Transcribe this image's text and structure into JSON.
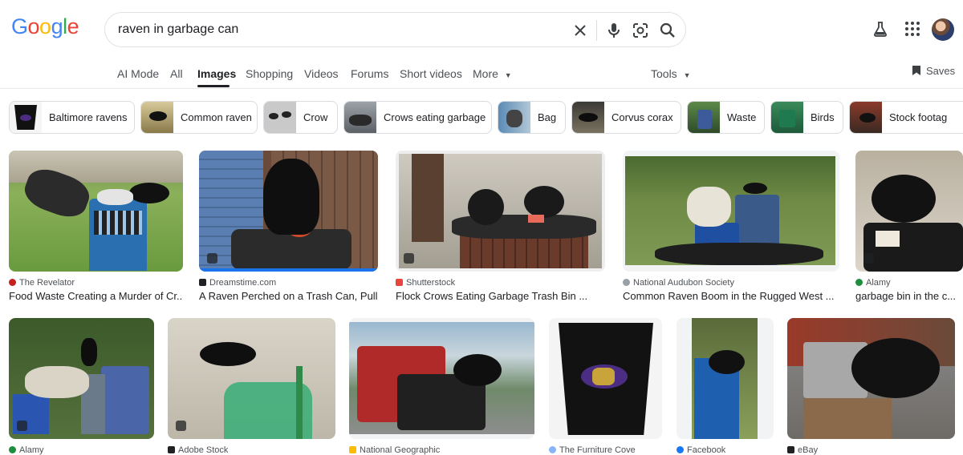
{
  "header": {
    "logo_letters": [
      {
        "ch": "G",
        "color": "#4285F4"
      },
      {
        "ch": "o",
        "color": "#EA4335"
      },
      {
        "ch": "o",
        "color": "#FBBC05"
      },
      {
        "ch": "g",
        "color": "#4285F4"
      },
      {
        "ch": "l",
        "color": "#34A853"
      },
      {
        "ch": "e",
        "color": "#EA4335"
      }
    ],
    "search_query": "raven in garbage can",
    "icons": [
      "clear-icon",
      "microphone-icon",
      "lens-icon",
      "search-icon",
      "labs-flask-icon",
      "apps-grid-icon",
      "avatar"
    ]
  },
  "tabs": {
    "items": [
      "AI Mode",
      "All",
      "Images",
      "Shopping",
      "Videos",
      "Forums",
      "Short videos",
      "More"
    ],
    "active": "Images",
    "tools": "Tools",
    "saves": "Saves"
  },
  "chips": [
    {
      "label": "Baltimore ravens"
    },
    {
      "label": "Common raven"
    },
    {
      "label": "Crow"
    },
    {
      "label": "Crows eating garbage"
    },
    {
      "label": "Bag"
    },
    {
      "label": "Corvus corax"
    },
    {
      "label": "Waste"
    },
    {
      "label": "Birds"
    },
    {
      "label": "Stock footag"
    }
  ],
  "results_row1": [
    {
      "source": "The Revelator",
      "title": "Food Waste Creating a Murder of Cr...",
      "source_color": "#c5221f"
    },
    {
      "source": "Dreamstime.com",
      "title": "A Raven Perched on a Trash Can, Pull...",
      "source_color": "#202124"
    },
    {
      "source": "Shutterstock",
      "title": "Flock Crows Eating Garbage Trash Bin ...",
      "source_color": "#e8453c"
    },
    {
      "source": "National Audubon Society",
      "title": "Common Raven Boom in the Rugged West ...",
      "source_color": "#9aa0a6"
    },
    {
      "source": "Alamy",
      "title": "garbage bin in the c...",
      "source_color": "#1e8e3e"
    }
  ],
  "results_row2": [
    {
      "source": "Alamy",
      "source_color": "#1e8e3e"
    },
    {
      "source": "Adobe Stock",
      "source_color": "#202124"
    },
    {
      "source": "National Geographic",
      "source_color": "#fbbc04"
    },
    {
      "source": "The Furniture Cove",
      "source_color": "#8ab4f8"
    },
    {
      "source": "Facebook",
      "source_color": "#1877f2"
    },
    {
      "source": "eBay",
      "source_color": "#202124"
    }
  ]
}
